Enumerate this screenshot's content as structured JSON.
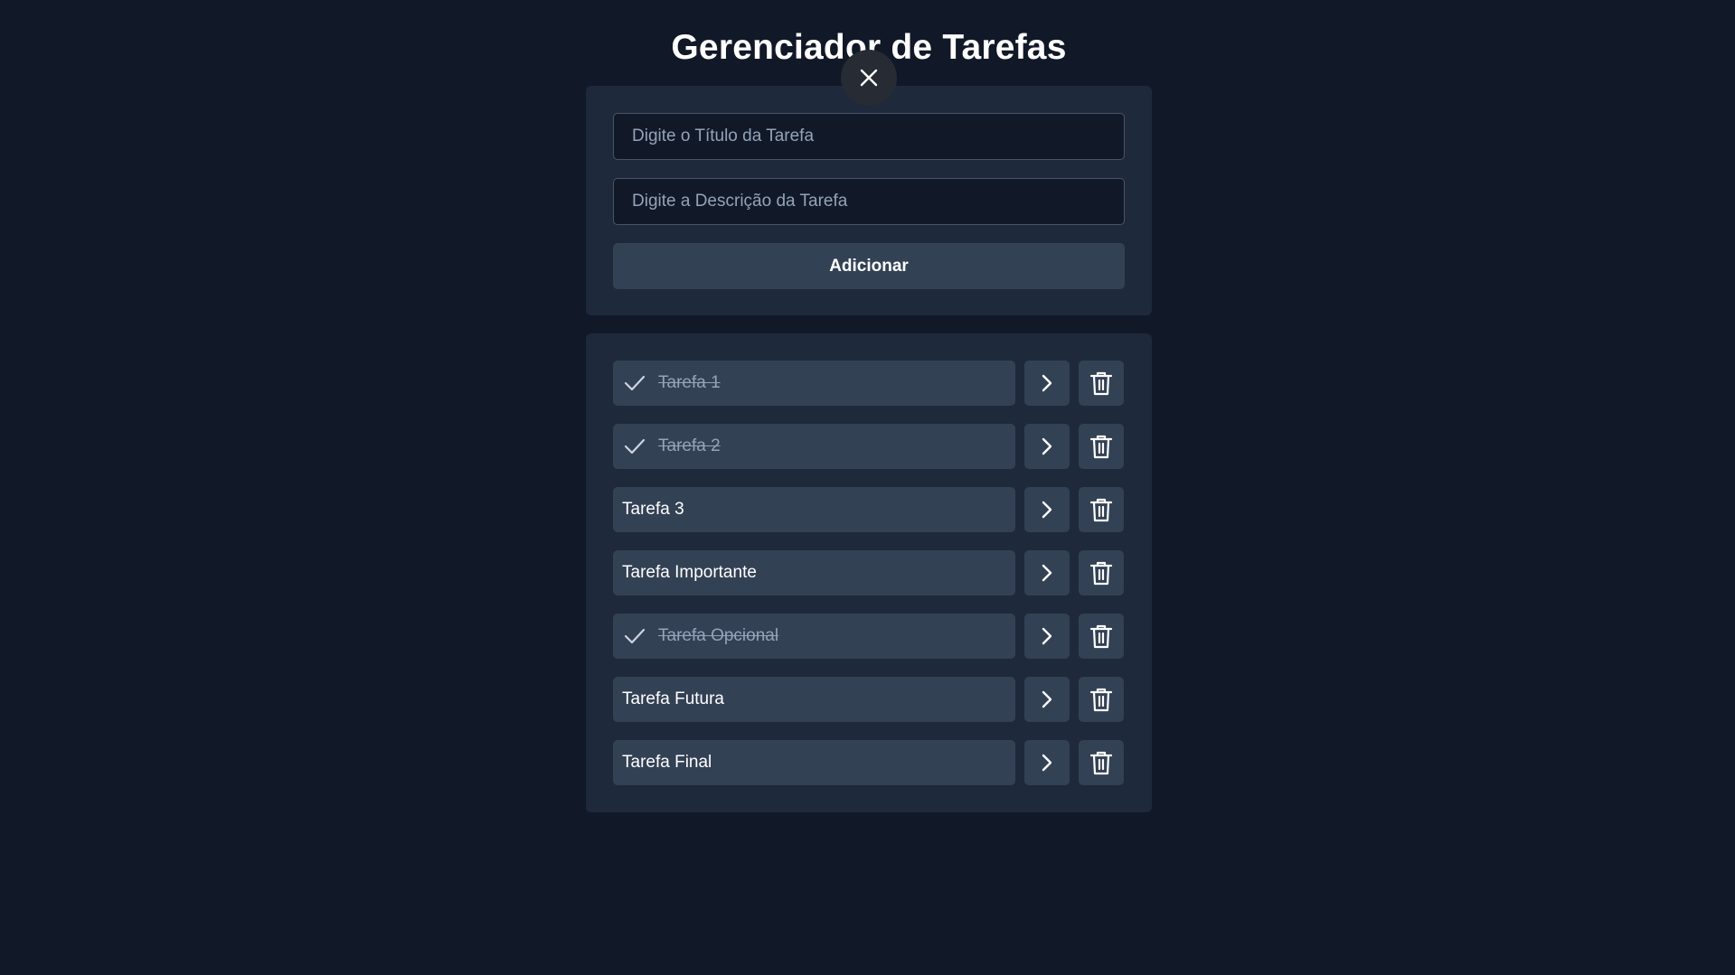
{
  "header": {
    "title": "Gerenciador de Tarefas"
  },
  "form": {
    "title_placeholder": "Digite o Título da Tarefa",
    "description_placeholder": "Digite a Descrição da Tarefa",
    "add_label": "Adicionar"
  },
  "tasks": [
    {
      "title": "Tarefa 1",
      "completed": true
    },
    {
      "title": "Tarefa 2",
      "completed": true
    },
    {
      "title": "Tarefa 3",
      "completed": false
    },
    {
      "title": "Tarefa Importante",
      "completed": false
    },
    {
      "title": "Tarefa Opcional",
      "completed": true
    },
    {
      "title": "Tarefa Futura",
      "completed": false
    },
    {
      "title": "Tarefa Final",
      "completed": false
    }
  ],
  "icons": {
    "close": "close-icon",
    "completed": "check-icon",
    "open": "chevron-right-icon",
    "delete": "trash-icon"
  },
  "colors": {
    "background": "#111827",
    "card": "#1e293b",
    "button": "#334155",
    "completed_text": "#94a3b8"
  }
}
